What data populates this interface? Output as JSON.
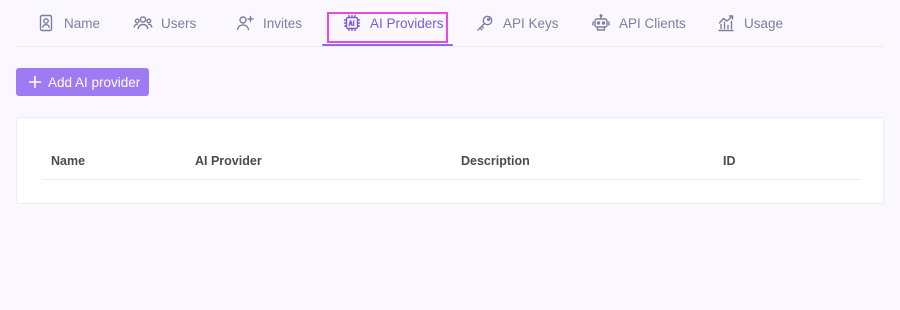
{
  "tabs": [
    {
      "label": "Name",
      "icon": "id-badge-icon",
      "active": false
    },
    {
      "label": "Users",
      "icon": "users-icon",
      "active": false
    },
    {
      "label": "Invites",
      "icon": "user-plus-icon",
      "active": false
    },
    {
      "label": "AI Providers",
      "icon": "ai-chip-icon",
      "active": true
    },
    {
      "label": "API Keys",
      "icon": "key-icon",
      "active": false
    },
    {
      "label": "API Clients",
      "icon": "robot-icon",
      "active": false
    },
    {
      "label": "Usage",
      "icon": "chart-icon",
      "active": false
    }
  ],
  "actions": {
    "add_provider_label": "Add AI provider"
  },
  "table": {
    "columns": [
      "Name",
      "AI Provider",
      "Description",
      "ID"
    ],
    "rows": []
  },
  "colors": {
    "accent": "#9f7bf3",
    "active_tab": "#7c5bd6",
    "focus_outline": "#e44be4",
    "background": "#faf8fe"
  }
}
